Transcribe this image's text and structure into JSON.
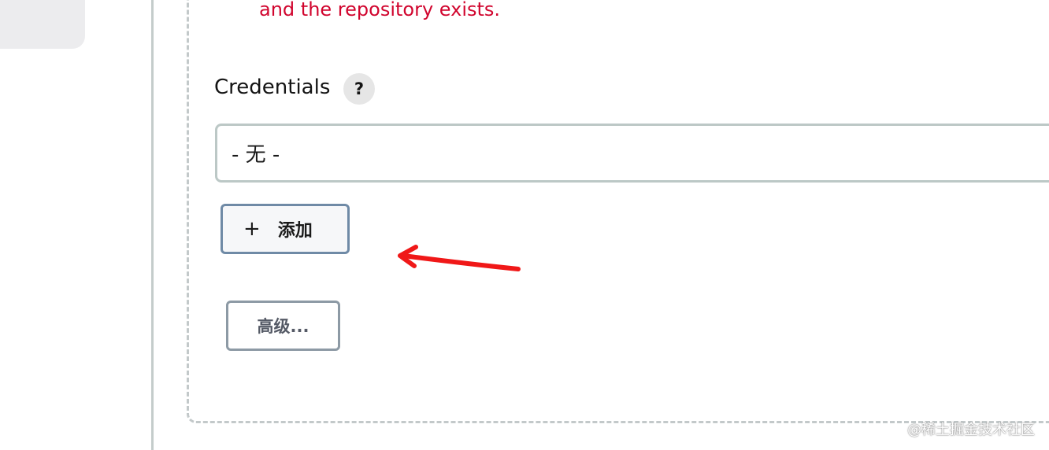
{
  "error_message": "and the repository exists.",
  "credentials": {
    "label": "Credentials",
    "help_symbol": "?",
    "selected_value": "- 无 -",
    "add_icon": "+",
    "add_label": "添加"
  },
  "advanced_button_label": "高级...",
  "annotation": {
    "arrow_color": "#f01818",
    "points_to": "add-button"
  },
  "watermark": "@稀土掘金技术社区",
  "colors": {
    "error": "#d1052e",
    "add_button_border": "#6f8aa6",
    "advanced_button_border": "#8d9aa5",
    "select_border": "#bcc8c6",
    "dashed_border": "#c3c9ca"
  }
}
